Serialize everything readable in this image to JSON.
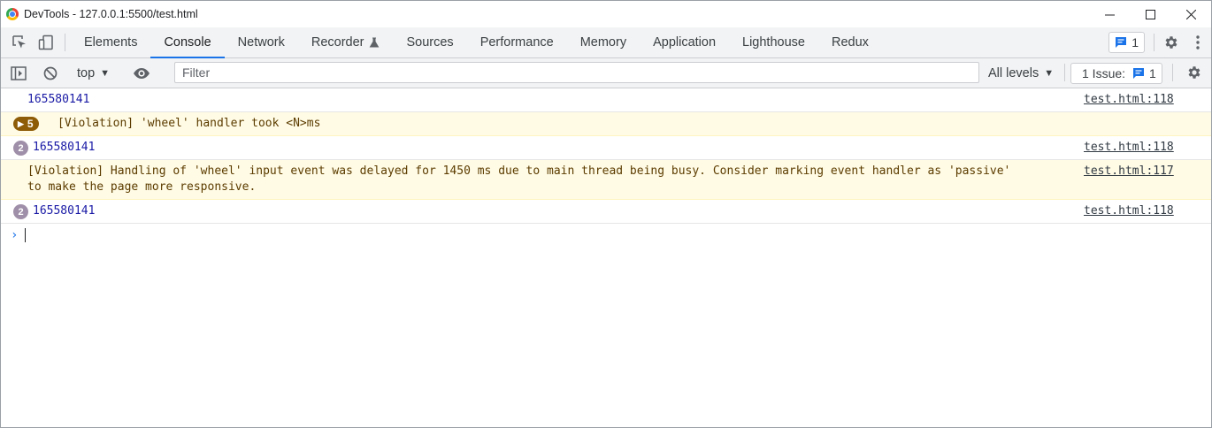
{
  "window": {
    "title": "DevTools - 127.0.0.1:5500/test.html"
  },
  "tabs": [
    {
      "label": "Elements"
    },
    {
      "label": "Console"
    },
    {
      "label": "Network"
    },
    {
      "label": "Recorder"
    },
    {
      "label": "Sources"
    },
    {
      "label": "Performance"
    },
    {
      "label": "Memory"
    },
    {
      "label": "Application"
    },
    {
      "label": "Lighthouse"
    },
    {
      "label": "Redux"
    }
  ],
  "active_tab": "Console",
  "tabbar_right": {
    "messages_count": "1"
  },
  "console_toolbar": {
    "context": "top",
    "filter_placeholder": "Filter",
    "levels": "All levels",
    "issues_label": "1 Issue:",
    "issues_count": "1"
  },
  "messages": [
    {
      "text": "165580141",
      "source": "test.html:118"
    },
    {
      "text": "[Violation] 'wheel' handler took <N>ms",
      "repeat": "5"
    },
    {
      "text": "165580141",
      "source": "test.html:118",
      "repeat": "2"
    },
    {
      "text": "[Violation] Handling of 'wheel' input event was delayed for 1450 ms due to main thread being busy. Consider marking event handler as 'passive'\nto make the page more responsive.",
      "source": "test.html:117"
    },
    {
      "text": "165580141",
      "source": "test.html:118",
      "repeat": "2"
    }
  ],
  "colors": {
    "accent": "#1a73e8",
    "warning_bg": "#fffbe5",
    "warning_text": "#5c3c00",
    "number_text": "#1a1aa6",
    "repeat_warn_pill": "#8e5c07",
    "repeat_circle": "#9f8fa8"
  }
}
